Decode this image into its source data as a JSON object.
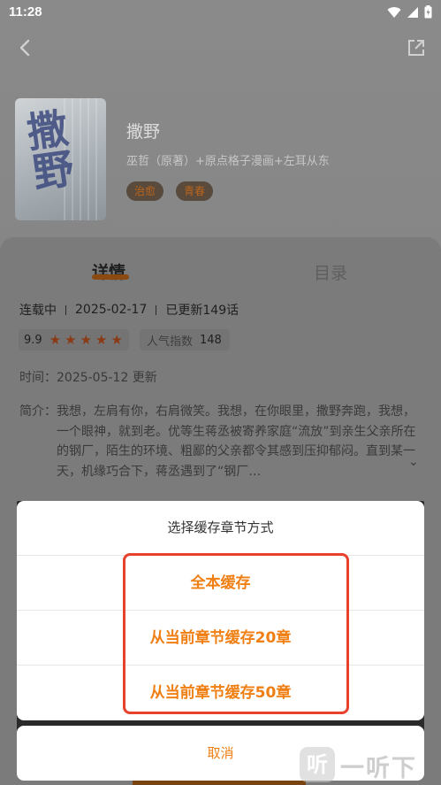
{
  "status_bar": {
    "time": "11:28"
  },
  "book": {
    "title": "撒野",
    "cover_text": "撒野",
    "authors": "巫哲（原著）+原点格子漫画+左耳从东",
    "tags": [
      "治愈",
      "青春"
    ]
  },
  "tabs": {
    "detail": "详情",
    "catalog": "目录"
  },
  "meta": {
    "status": "连载中",
    "date": "2025-02-17",
    "updated": "已更新149话"
  },
  "rating": {
    "score": "9.9",
    "stars": 5,
    "popularity_label": "人气指数",
    "popularity_value": "148"
  },
  "time_row": "时间：2025-05-12 更新",
  "intro": {
    "label": "简介：",
    "text": "我想，左肩有你，右肩微笑。我想，在你眼里，撒野奔跑，我想，一个眼神，就到老。优等生蒋丞被寄养家庭“流放”到亲生父亲所在的钢厂，陌生的环境、粗鄙的父亲都令其感到压抑郁闷。直到某一天，机缘巧合下，蒋丞遇到了“钢厂…"
  },
  "dialog": {
    "title": "选择缓存章节方式",
    "options": [
      "全本缓存",
      "从当前章节缓存20章",
      "从当前章节缓存50章"
    ],
    "cancel": "取消"
  },
  "watermark": {
    "icon_text": "听",
    "text": "一听下载"
  },
  "colors": {
    "accent": "#f07f13",
    "highlight": "#e8412c"
  }
}
